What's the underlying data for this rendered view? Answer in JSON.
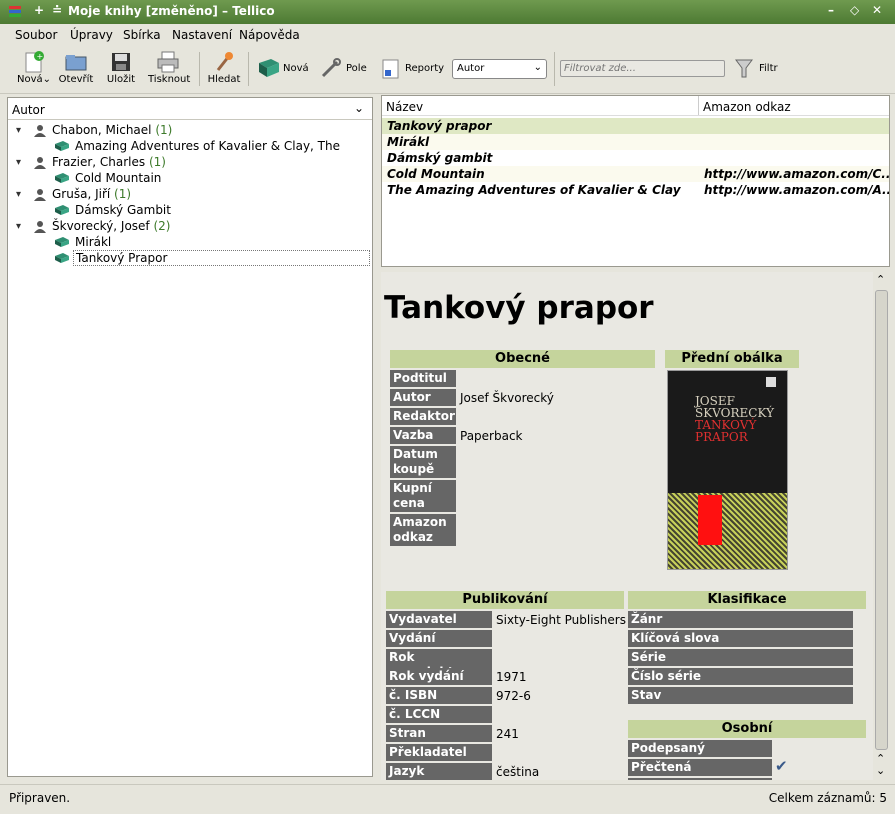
{
  "window": {
    "title": "Moje knihy [změněno] – Tellico"
  },
  "menu": [
    "Soubor",
    "Úpravy",
    "Sbírka",
    "Nastavení",
    "Nápověda"
  ],
  "toolbar": {
    "new": "Nová",
    "open": "Otevřít",
    "save": "Uložit",
    "print": "Tisknout",
    "find": "Hledat",
    "new_entry": "Nová",
    "fields": "Pole",
    "reports": "Reporty",
    "group_select": "Autor",
    "filter_placeholder": "Filtrovat zde...",
    "filter": "Filtr"
  },
  "group_header": "Autor",
  "tree": [
    {
      "author": "Chabon, Michael",
      "count": "(1)",
      "books": [
        "Amazing Adventures of Kavalier & Clay, The"
      ]
    },
    {
      "author": "Frazier, Charles",
      "count": "(1)",
      "books": [
        "Cold Mountain"
      ]
    },
    {
      "author": "Gruša, Jiří",
      "count": "(1)",
      "books": [
        "Dámský Gambit"
      ]
    },
    {
      "author": "Škvorecký, Josef",
      "count": "(2)",
      "books": [
        "Mirákl",
        "Tankový Prapor"
      ]
    }
  ],
  "list": {
    "columns": [
      "Název",
      "Amazon odkaz"
    ],
    "rows": [
      {
        "title": "Tankový prapor",
        "link": ""
      },
      {
        "title": "Mirákl",
        "link": ""
      },
      {
        "title": "Dámský gambit",
        "link": ""
      },
      {
        "title": "Cold Mountain",
        "link": "http://www.amazon.com/C..."
      },
      {
        "title": "The Amazing Adventures of Kavalier & Clay",
        "link": "http://www.amazon.com/A..."
      }
    ]
  },
  "detail": {
    "title": "Tankový prapor",
    "general": {
      "header": "Obecné",
      "subtitle": "Podtitul",
      "author": "Autor",
      "author_val": "Josef Škvorecký",
      "editor": "Redaktor",
      "binding": "Vazba",
      "binding_val": "Paperback",
      "pdate1": "Datum",
      "pdate2": "koupě",
      "price1": "Kupní",
      "price2": "cena",
      "amazon1": "Amazon",
      "amazon2": "odkaz"
    },
    "cover": {
      "header": "Přední obálka",
      "line1": "JOSEF",
      "line2": "ŠKVORECKÝ",
      "line3": "TANKOVÝ",
      "line4": "PRAPOR"
    },
    "publishing": {
      "header": "Publikování",
      "publisher": "Vydavatel",
      "publisher_val": "Sixty-Eight Publishers",
      "edition": "Vydání",
      "copyright": "Rok copyrightu",
      "year": "Rok vydání",
      "year_val": "1971",
      "isbn": "č. ISBN",
      "isbn_val": "972-6",
      "lccn": "č. LCCN",
      "pages": "Stran",
      "pages_val": "241",
      "translator": "Překladatel",
      "language": "Jazyk",
      "language_val": "čeština"
    },
    "classification": {
      "header": "Klasifikace",
      "genre": "Žánr",
      "keywords": "Klíčová slova",
      "series": "Série",
      "series_num": "Číslo série",
      "status": "Stav"
    },
    "personal": {
      "header": "Osobní",
      "signed": "Podepsaný",
      "read": "Přečtená"
    }
  },
  "status": {
    "left": "Připraven.",
    "right": "Celkem záznamů: 5"
  }
}
